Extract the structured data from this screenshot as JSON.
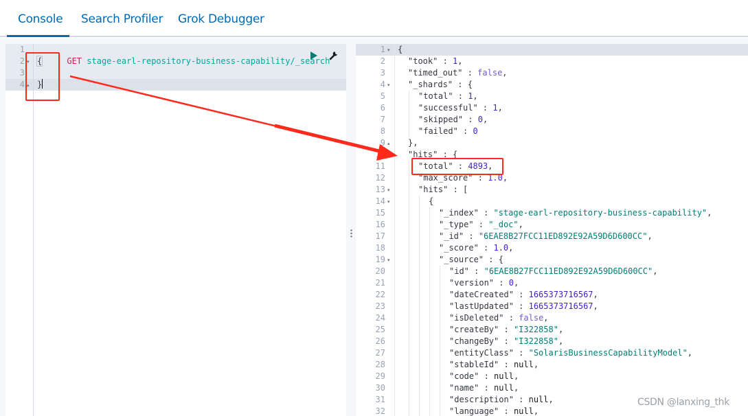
{
  "tabs": [
    {
      "label": "Console",
      "active": true
    },
    {
      "label": "Search Profiler",
      "active": false
    },
    {
      "label": "Grok Debugger",
      "active": false
    }
  ],
  "request": {
    "method": "GET",
    "path": "stage-earl-repository-business-capability/_search",
    "lines": [
      {
        "n": "1",
        "text": ""
      },
      {
        "n": "2",
        "text": "{"
      },
      {
        "n": "3",
        "text": ""
      },
      {
        "n": "4",
        "text": "}"
      }
    ]
  },
  "response": {
    "lines": [
      {
        "n": "1",
        "fold": "▾",
        "indent": 0,
        "parts": [
          [
            "punct",
            "{"
          ]
        ]
      },
      {
        "n": "2",
        "indent": 1,
        "parts": [
          [
            "kstr",
            "\"took\""
          ],
          [
            "punct",
            " : "
          ],
          [
            "num",
            "1"
          ],
          [
            "punct",
            ","
          ]
        ]
      },
      {
        "n": "3",
        "indent": 1,
        "parts": [
          [
            "kstr",
            "\"timed_out\""
          ],
          [
            "punct",
            " : "
          ],
          [
            "bool",
            "false"
          ],
          [
            "punct",
            ","
          ]
        ]
      },
      {
        "n": "4",
        "fold": "▾",
        "indent": 1,
        "parts": [
          [
            "kstr",
            "\"_shards\""
          ],
          [
            "punct",
            " : {"
          ]
        ]
      },
      {
        "n": "5",
        "indent": 2,
        "parts": [
          [
            "kstr",
            "\"total\""
          ],
          [
            "punct",
            " : "
          ],
          [
            "num",
            "1"
          ],
          [
            "punct",
            ","
          ]
        ]
      },
      {
        "n": "6",
        "indent": 2,
        "parts": [
          [
            "kstr",
            "\"successful\""
          ],
          [
            "punct",
            " : "
          ],
          [
            "num",
            "1"
          ],
          [
            "punct",
            ","
          ]
        ]
      },
      {
        "n": "7",
        "indent": 2,
        "parts": [
          [
            "kstr",
            "\"skipped\""
          ],
          [
            "punct",
            " : "
          ],
          [
            "num",
            "0"
          ],
          [
            "punct",
            ","
          ]
        ]
      },
      {
        "n": "8",
        "indent": 2,
        "parts": [
          [
            "kstr",
            "\"failed\""
          ],
          [
            "punct",
            " : "
          ],
          [
            "num",
            "0"
          ]
        ]
      },
      {
        "n": "9",
        "fold": "▴",
        "indent": 1,
        "parts": [
          [
            "punct",
            "},"
          ]
        ]
      },
      {
        "n": "10",
        "indent": 1,
        "parts": [
          [
            "kstr",
            "\"hits\""
          ],
          [
            "punct",
            " : {"
          ]
        ]
      },
      {
        "n": "11",
        "indent": 2,
        "parts": [
          [
            "kstr",
            "\"total\""
          ],
          [
            "punct",
            " : "
          ],
          [
            "num",
            "4893"
          ],
          [
            "punct",
            ","
          ]
        ]
      },
      {
        "n": "12",
        "indent": 2,
        "parts": [
          [
            "kstr",
            "\"max_score\""
          ],
          [
            "punct",
            " : "
          ],
          [
            "num",
            "1.0"
          ],
          [
            "punct",
            ","
          ]
        ]
      },
      {
        "n": "13",
        "fold": "▾",
        "indent": 2,
        "parts": [
          [
            "kstr",
            "\"hits\""
          ],
          [
            "punct",
            " : ["
          ]
        ]
      },
      {
        "n": "14",
        "fold": "▾",
        "indent": 3,
        "parts": [
          [
            "punct",
            "{"
          ]
        ]
      },
      {
        "n": "15",
        "indent": 4,
        "parts": [
          [
            "kstr",
            "\"_index\""
          ],
          [
            "punct",
            " : "
          ],
          [
            "str",
            "\"stage-earl-repository-business-capability\""
          ],
          [
            "punct",
            ","
          ]
        ]
      },
      {
        "n": "16",
        "indent": 4,
        "parts": [
          [
            "kstr",
            "\"_type\""
          ],
          [
            "punct",
            " : "
          ],
          [
            "str",
            "\"_doc\""
          ],
          [
            "punct",
            ","
          ]
        ]
      },
      {
        "n": "17",
        "indent": 4,
        "parts": [
          [
            "kstr",
            "\"_id\""
          ],
          [
            "punct",
            " : "
          ],
          [
            "str",
            "\"6EAE8B27FCC11ED892E92A59D6D600CC\""
          ],
          [
            "punct",
            ","
          ]
        ]
      },
      {
        "n": "18",
        "indent": 4,
        "parts": [
          [
            "kstr",
            "\"_score\""
          ],
          [
            "punct",
            " : "
          ],
          [
            "num",
            "1.0"
          ],
          [
            "punct",
            ","
          ]
        ]
      },
      {
        "n": "19",
        "fold": "▾",
        "indent": 4,
        "parts": [
          [
            "kstr",
            "\"_source\""
          ],
          [
            "punct",
            " : {"
          ]
        ]
      },
      {
        "n": "20",
        "indent": 5,
        "parts": [
          [
            "kstr",
            "\"id\""
          ],
          [
            "punct",
            " : "
          ],
          [
            "str",
            "\"6EAE8B27FCC11ED892E92A59D6D600CC\""
          ],
          [
            "punct",
            ","
          ]
        ]
      },
      {
        "n": "21",
        "indent": 5,
        "parts": [
          [
            "kstr",
            "\"version\""
          ],
          [
            "punct",
            " : "
          ],
          [
            "num",
            "0"
          ],
          [
            "punct",
            ","
          ]
        ]
      },
      {
        "n": "22",
        "indent": 5,
        "parts": [
          [
            "kstr",
            "\"dateCreated\""
          ],
          [
            "punct",
            " : "
          ],
          [
            "num",
            "1665373716567"
          ],
          [
            "punct",
            ","
          ]
        ]
      },
      {
        "n": "23",
        "indent": 5,
        "parts": [
          [
            "kstr",
            "\"lastUpdated\""
          ],
          [
            "punct",
            " : "
          ],
          [
            "num",
            "1665373716567"
          ],
          [
            "punct",
            ","
          ]
        ]
      },
      {
        "n": "24",
        "indent": 5,
        "parts": [
          [
            "kstr",
            "\"isDeleted\""
          ],
          [
            "punct",
            " : "
          ],
          [
            "bool",
            "false"
          ],
          [
            "punct",
            ","
          ]
        ]
      },
      {
        "n": "25",
        "indent": 5,
        "parts": [
          [
            "kstr",
            "\"createBy\""
          ],
          [
            "punct",
            " : "
          ],
          [
            "str",
            "\"I322858\""
          ],
          [
            "punct",
            ","
          ]
        ]
      },
      {
        "n": "26",
        "indent": 5,
        "parts": [
          [
            "kstr",
            "\"changeBy\""
          ],
          [
            "punct",
            " : "
          ],
          [
            "str",
            "\"I322858\""
          ],
          [
            "punct",
            ","
          ]
        ]
      },
      {
        "n": "27",
        "indent": 5,
        "parts": [
          [
            "kstr",
            "\"entityClass\""
          ],
          [
            "punct",
            " : "
          ],
          [
            "str",
            "\"SolarisBusinessCapabilityModel\""
          ],
          [
            "punct",
            ","
          ]
        ]
      },
      {
        "n": "28",
        "indent": 5,
        "parts": [
          [
            "kstr",
            "\"stableId\""
          ],
          [
            "punct",
            " : "
          ],
          [
            "nul",
            "null"
          ],
          [
            "punct",
            ","
          ]
        ]
      },
      {
        "n": "29",
        "indent": 5,
        "parts": [
          [
            "kstr",
            "\"code\""
          ],
          [
            "punct",
            " : "
          ],
          [
            "nul",
            "null"
          ],
          [
            "punct",
            ","
          ]
        ]
      },
      {
        "n": "30",
        "indent": 5,
        "parts": [
          [
            "kstr",
            "\"name\""
          ],
          [
            "punct",
            " : "
          ],
          [
            "nul",
            "null"
          ],
          [
            "punct",
            ","
          ]
        ]
      },
      {
        "n": "31",
        "indent": 5,
        "parts": [
          [
            "kstr",
            "\"description\""
          ],
          [
            "punct",
            " : "
          ],
          [
            "nul",
            "null"
          ],
          [
            "punct",
            ","
          ]
        ]
      },
      {
        "n": "32",
        "indent": 5,
        "parts": [
          [
            "kstr",
            "\"language\""
          ],
          [
            "punct",
            " : "
          ],
          [
            "nul",
            "null"
          ],
          [
            "punct",
            ","
          ]
        ]
      }
    ]
  },
  "icons": {
    "run": "play-icon",
    "settings": "wrench-icon",
    "resize": "vertical-dots-icon"
  },
  "annotation": {
    "color": "#ff2a1c"
  },
  "watermark": "CSDN @lanxing_thk"
}
